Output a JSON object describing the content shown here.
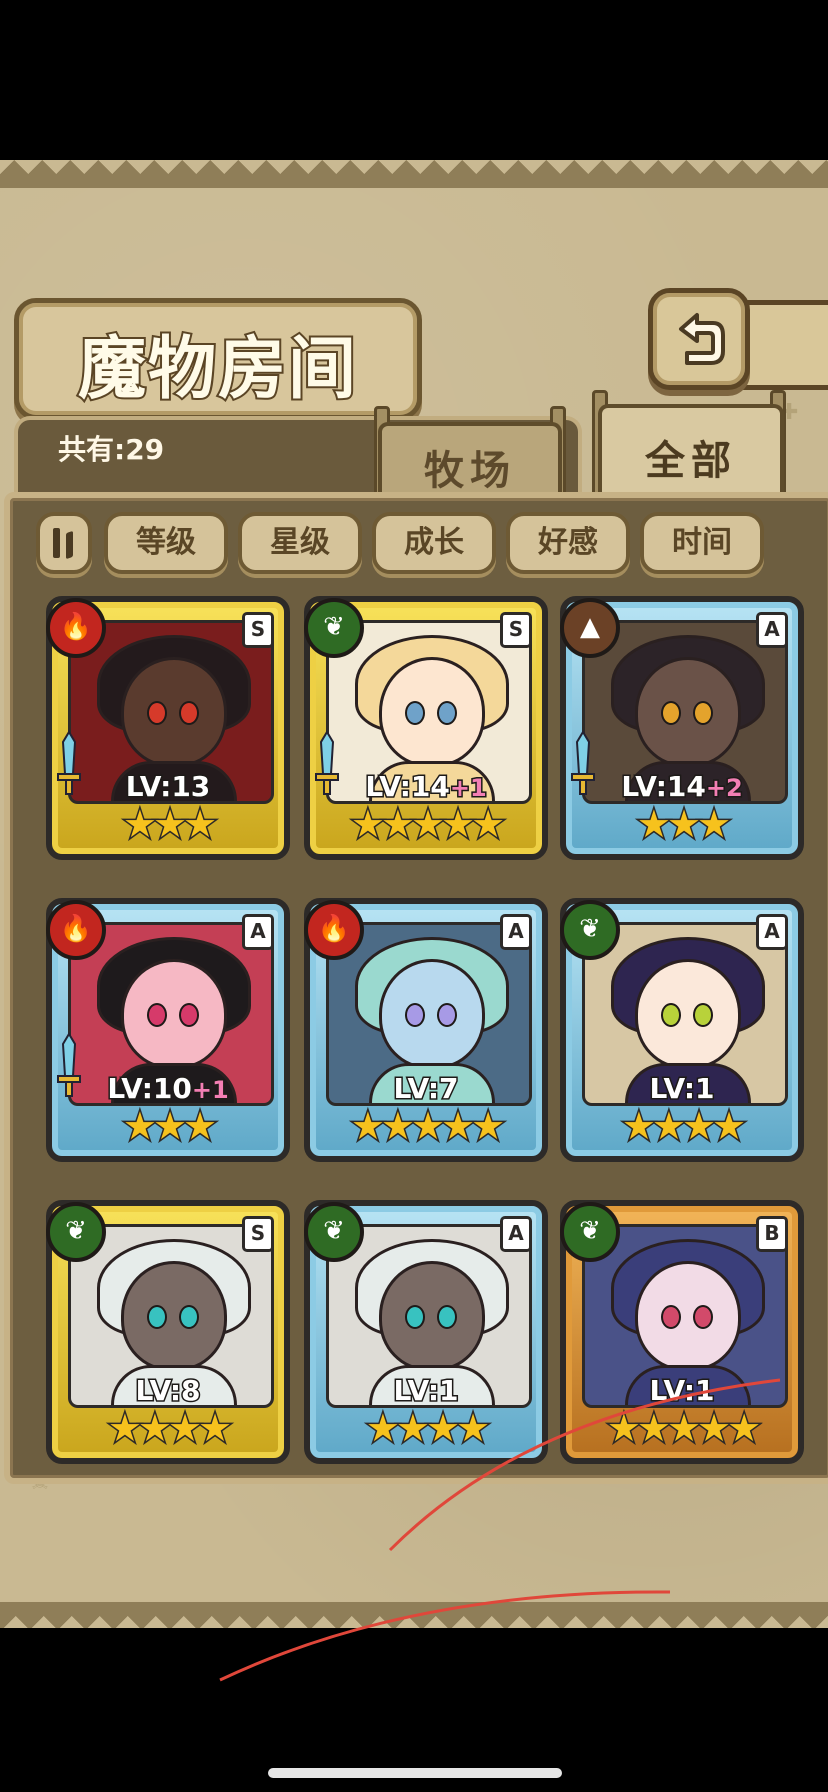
{
  "title": "魔物房间",
  "count_label": "共有:29",
  "tabs": [
    {
      "label": "牧场",
      "active": false
    },
    {
      "label": "全部",
      "active": true
    }
  ],
  "filters": [
    "等级",
    "星级",
    "成长",
    "好感",
    "时间"
  ],
  "colors": {
    "gold_frame": "#f2d43a",
    "blue_frame": "#8ccbe4",
    "bronze_frame": "#e09a3a",
    "fire": "#c2261f",
    "leaf": "#2f6b24",
    "earth": "#6b4126",
    "star": "#f6c21d",
    "plus_pink": "#f37fb4",
    "scribble_red": "#e0473a"
  },
  "monsters": [
    {
      "rank": "S",
      "element": "fire-icon",
      "level": "LV:13",
      "bonus": "",
      "stars": "★★★",
      "frame": "gold",
      "weapon": true
    },
    {
      "rank": "S",
      "element": "leaf-icon",
      "level": "LV:14",
      "bonus": "+1",
      "stars": "★★★★★",
      "frame": "gold",
      "weapon": true
    },
    {
      "rank": "A",
      "element": "earth-icon",
      "level": "LV:14",
      "bonus": "+2",
      "stars": "★★★",
      "frame": "blue",
      "weapon": true
    },
    {
      "rank": "A",
      "element": "fire-icon",
      "level": "LV:10",
      "bonus": "+1",
      "stars": "★★★",
      "frame": "blue",
      "weapon": true
    },
    {
      "rank": "A",
      "element": "fire-icon",
      "level": "LV:7",
      "bonus": "",
      "stars": "★★★★★",
      "frame": "blue",
      "weapon": false
    },
    {
      "rank": "A",
      "element": "leaf-icon",
      "level": "LV:1",
      "bonus": "",
      "stars": "★★★★",
      "frame": "blue",
      "weapon": false
    },
    {
      "rank": "S",
      "element": "leaf-icon",
      "level": "LV:8",
      "bonus": "",
      "stars": "★★★★",
      "frame": "gold",
      "weapon": false
    },
    {
      "rank": "A",
      "element": "leaf-icon",
      "level": "LV:1",
      "bonus": "",
      "stars": "★★★★",
      "frame": "blue",
      "weapon": false
    },
    {
      "rank": "B",
      "element": "leaf-icon",
      "level": "LV:1",
      "bonus": "",
      "stars": "★★★★★",
      "frame": "bronze",
      "weapon": false
    }
  ]
}
